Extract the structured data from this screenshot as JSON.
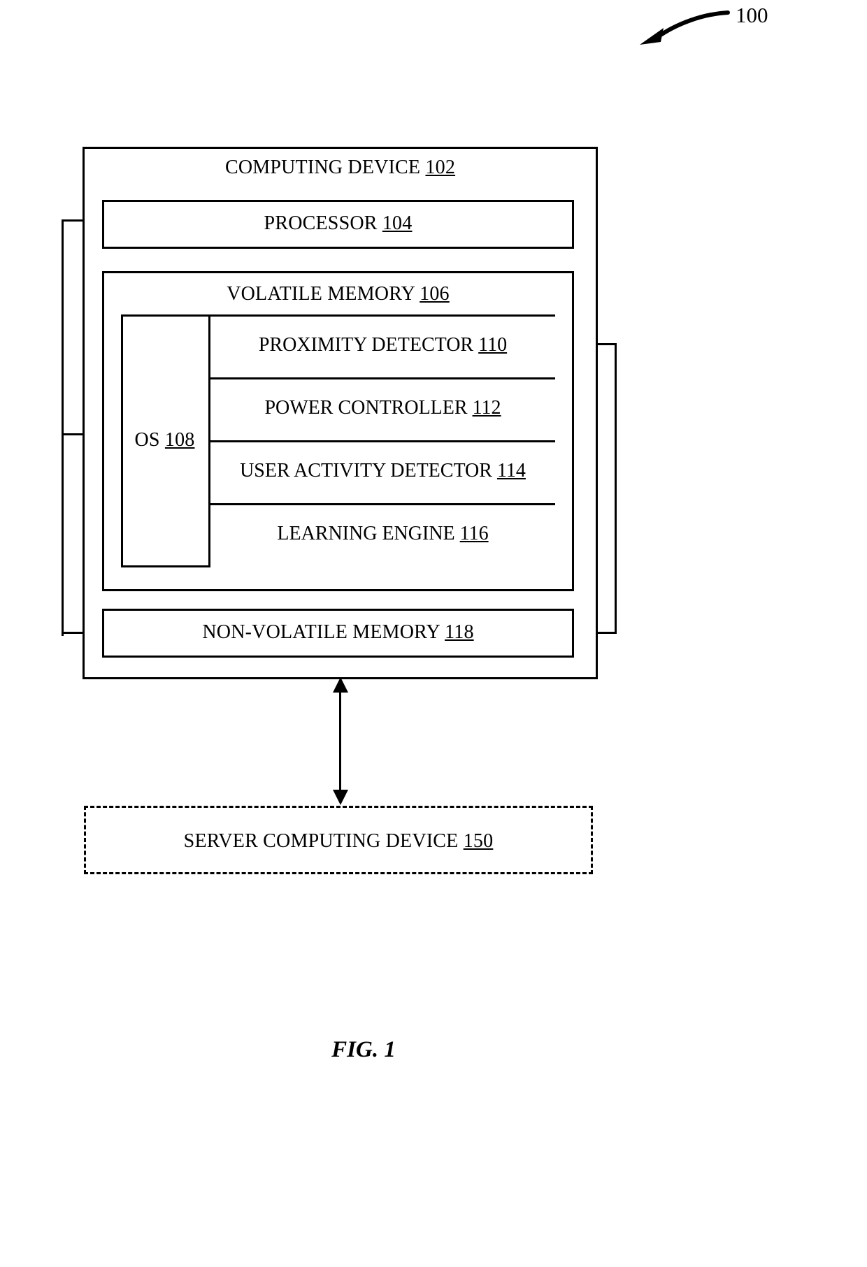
{
  "figure": {
    "reference_numeral": "100",
    "caption": "FIG. 1"
  },
  "computing_device": {
    "label": "COMPUTING DEVICE",
    "numeral": "102",
    "processor": {
      "label": "PROCESSOR",
      "numeral": "104"
    },
    "volatile_memory": {
      "label": "VOLATILE MEMORY",
      "numeral": "106",
      "os": {
        "label": "OS",
        "numeral": "108"
      },
      "modules": [
        {
          "label": "PROXIMITY DETECTOR",
          "numeral": "110"
        },
        {
          "label": "POWER CONTROLLER",
          "numeral": "112"
        },
        {
          "label": "USER ACTIVITY DETECTOR",
          "numeral": "114"
        },
        {
          "label": "LEARNING ENGINE",
          "numeral": "116"
        }
      ]
    },
    "non_volatile_memory": {
      "label": "NON-VOLATILE MEMORY",
      "numeral": "118"
    }
  },
  "server_device": {
    "label": "SERVER COMPUTING DEVICE",
    "numeral": "150",
    "border_style": "dashed"
  },
  "colors": {
    "line": "#000000",
    "background": "#ffffff"
  }
}
